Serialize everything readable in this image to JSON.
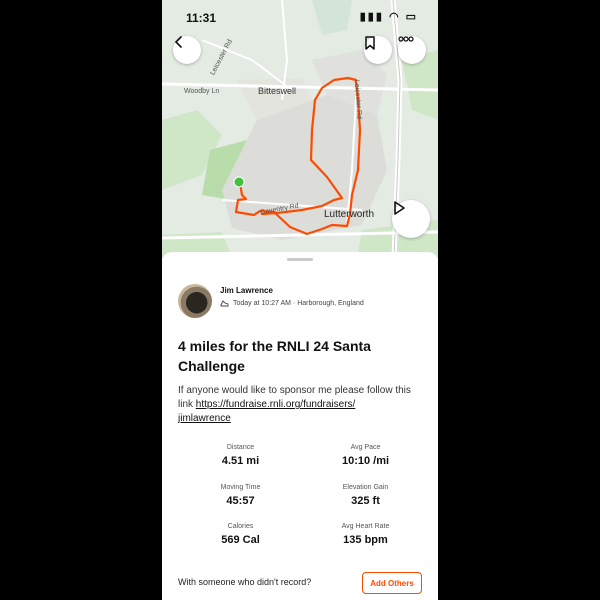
{
  "status_bar": {
    "time": "11:31",
    "icons": "▮▮▮ ◠ ▭"
  },
  "map": {
    "labels": {
      "road_1": "Leicester Rd",
      "road_2": "Woodby Ln",
      "road_3": "Bitteswell",
      "road_4": "Coventry Rd",
      "road_5": "Lutterworth",
      "road_6": "Leicester Rd"
    },
    "route_color": "#fc4c02",
    "start_color": "#44c13a"
  },
  "activity": {
    "athlete_name": "Jim Lawrence",
    "meta": "Today at 10:27 AM · Harborough, England",
    "title": "4 miles for the RNLI 24 Santa Challenge",
    "description_prefix": "If anyone would like to sponsor me please follow this link",
    "link": "https://fundraise.rnli.org/fundraisers/jimlawrence",
    "link_line1": "https://fundraise.rnli.org/fundraisers/",
    "link_line2": "jimlawrence"
  },
  "stats": [
    {
      "label": "Distance",
      "value": "4.51 mi"
    },
    {
      "label": "Avg Pace",
      "value": "10:10 /mi"
    },
    {
      "label": "Moving Time",
      "value": "45:57"
    },
    {
      "label": "Elevation Gain",
      "value": "325 ft"
    },
    {
      "label": "Calories",
      "value": "569 Cal"
    },
    {
      "label": "Avg Heart Rate",
      "value": "135 bpm"
    }
  ],
  "bottom": {
    "prompt": "With someone who didn't record?",
    "add_others_label": "Add Others"
  },
  "colors": {
    "accent": "#fc4c02",
    "background": "#ffffff"
  }
}
